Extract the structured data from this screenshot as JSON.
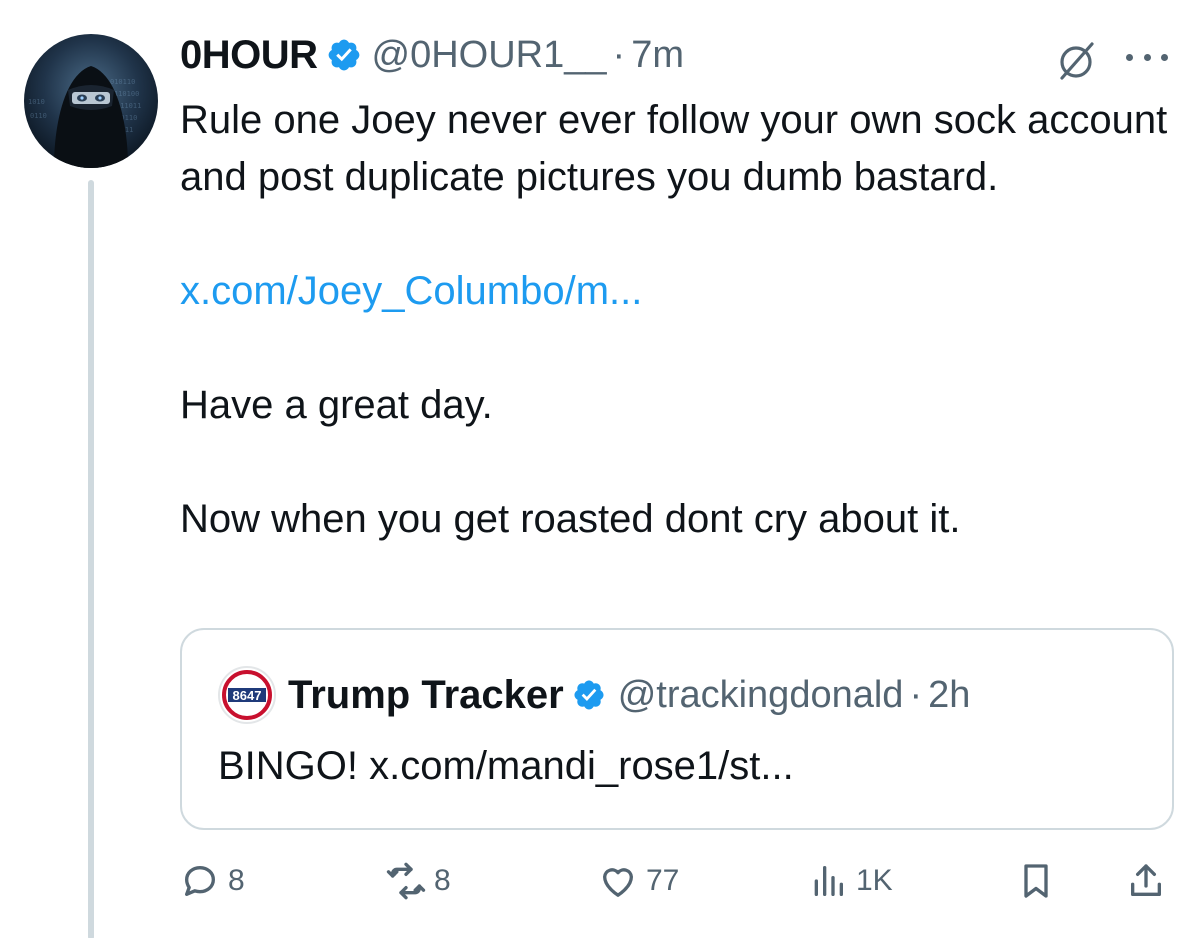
{
  "tweet": {
    "display_name": "0HOUR",
    "handle": "@0HOUR1__",
    "separator": "·",
    "time": "7m",
    "verified": true,
    "verified_icon": "verified-badge-icon",
    "grok_icon": "grok-icon",
    "more_icon": "more-dots-icon",
    "lines": [
      "Rule one Joey never ever follow your own sock account and post duplicate pictures you dumb bastard.",
      "x.com/Joey_Columbo/m...",
      "Have a great day.",
      "Now when you get roasted dont cry about it."
    ]
  },
  "quote": {
    "display_name": "Trump Tracker",
    "handle": "@trackingdonald",
    "separator": "·",
    "time": "2h",
    "avatar_text": "8647",
    "text": "BINGO! x.com/mandi_rose1/st..."
  },
  "actions": {
    "reply": {
      "icon": "reply-icon",
      "count": "8"
    },
    "repost": {
      "icon": "repost-icon",
      "count": "8"
    },
    "like": {
      "icon": "heart-icon",
      "count": "77"
    },
    "views": {
      "icon": "views-icon",
      "count": "1K"
    },
    "bookmark": {
      "icon": "bookmark-icon"
    },
    "share": {
      "icon": "share-icon"
    }
  },
  "colors": {
    "text": "#0f1419",
    "secondary": "#536471",
    "accent": "#1d9bf0",
    "border": "#cfd9de"
  }
}
